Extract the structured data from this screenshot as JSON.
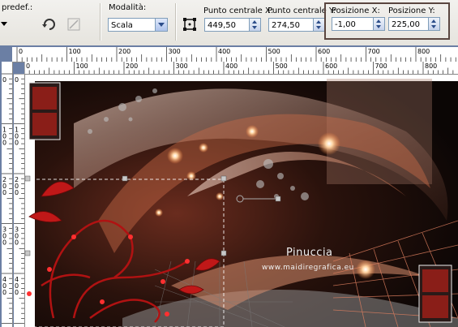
{
  "toolbar": {
    "preset_label": "predef.:",
    "mode_label": "Modalità:",
    "mode_value": "Scala",
    "center_x_label": "Punto centrale X:",
    "center_x_value": "449,50",
    "center_y_label": "Punto centrale Y:",
    "center_y_value": "274,50",
    "pos_x_label": "Posizione X:",
    "pos_x_value": "-1,00",
    "pos_y_label": "Posizione Y:",
    "pos_y_value": "225,00"
  },
  "icons": [
    "chevron-down-icon",
    "reset-icon",
    "clear-icon",
    "deform-icon",
    "spin-icon",
    "dropdown-icon"
  ],
  "ruler_top": [
    "0",
    "100",
    "200",
    "300",
    "400",
    "500",
    "600",
    "700",
    "800"
  ],
  "ruler_top_inner": [
    "0",
    "100",
    "200",
    "300",
    "400",
    "500",
    "600",
    "700",
    "800"
  ],
  "ruler_left": [
    "0",
    "1\n0\n0",
    "2\n0\n0",
    "3\n0\n0",
    "4\n0\n0"
  ],
  "ruler_left_inner": [
    "0",
    "1\n0\n0",
    "2\n0\n0",
    "3\n0\n0",
    "4\n0\n0"
  ],
  "canvas": {
    "watermark_title": "Pinuccia",
    "watermark_url": "www.maidiregrafica.eu"
  },
  "colors": {
    "highlight_border": "#5a4640",
    "ruler_bg": "#ffffff",
    "workspace": "#6b7fa4",
    "accent_copper": "#c8563a"
  }
}
